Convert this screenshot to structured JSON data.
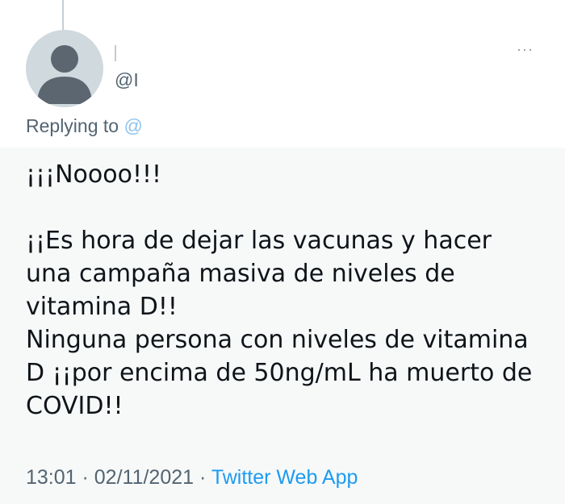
{
  "tweet": {
    "display_name": "",
    "handle": "@I",
    "replying_prefix": "Replying to ",
    "replying_handle": "@",
    "more_icon": "more-horizontal-icon",
    "text": "¡¡¡Noooo!!!\n\n¡¡Es hora de dejar las vacunas y hacer una campaña masiva de niveles de vitamina D!!\nNinguna persona con niveles de vitamina D ¡¡por encima de 50ng/mL ha muerto de COVID!!",
    "time": "13:01",
    "dot1": " · ",
    "date": "02/11/2021",
    "dot2": " · ",
    "source": "Twitter Web App"
  },
  "colors": {
    "link": "#1d9bf0",
    "secondary_text": "#536471",
    "primary_text": "#0f1419",
    "background_lower": "#f7f9f9"
  }
}
